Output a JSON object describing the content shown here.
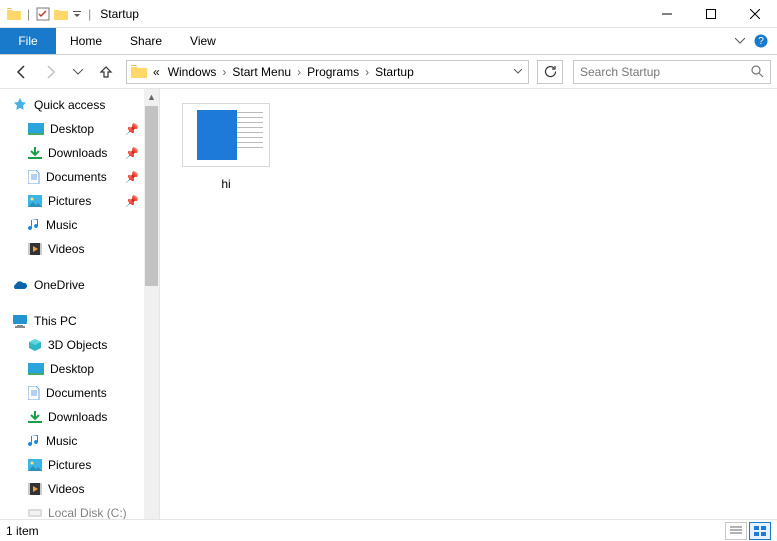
{
  "window": {
    "title": "Startup"
  },
  "ribbon": {
    "file_tab": "File",
    "tabs": [
      "Home",
      "Share",
      "View"
    ]
  },
  "nav": {
    "breadcrumb_prefix": "«",
    "breadcrumbs": [
      "Windows",
      "Start Menu",
      "Programs",
      "Startup"
    ],
    "search_placeholder": "Search Startup"
  },
  "tree": {
    "quick_access": "Quick access",
    "pinned": [
      {
        "label": "Desktop",
        "icon": "desktop"
      },
      {
        "label": "Downloads",
        "icon": "downloads"
      },
      {
        "label": "Documents",
        "icon": "documents"
      },
      {
        "label": "Pictures",
        "icon": "pictures"
      }
    ],
    "recent": [
      {
        "label": "Music",
        "icon": "music"
      },
      {
        "label": "Videos",
        "icon": "videos"
      }
    ],
    "onedrive": "OneDrive",
    "this_pc": "This PC",
    "pc_children": [
      {
        "label": "3D Objects",
        "icon": "3d"
      },
      {
        "label": "Desktop",
        "icon": "desktop"
      },
      {
        "label": "Documents",
        "icon": "documents"
      },
      {
        "label": "Downloads",
        "icon": "downloads"
      },
      {
        "label": "Music",
        "icon": "music"
      },
      {
        "label": "Pictures",
        "icon": "pictures"
      },
      {
        "label": "Videos",
        "icon": "videos"
      },
      {
        "label": "Local Disk (C:)",
        "icon": "disk"
      }
    ]
  },
  "content": {
    "items": [
      {
        "name": "hi",
        "type": "document"
      }
    ]
  },
  "statusbar": {
    "count_text": "1 item"
  },
  "colors": {
    "accent": "#1979ca"
  }
}
